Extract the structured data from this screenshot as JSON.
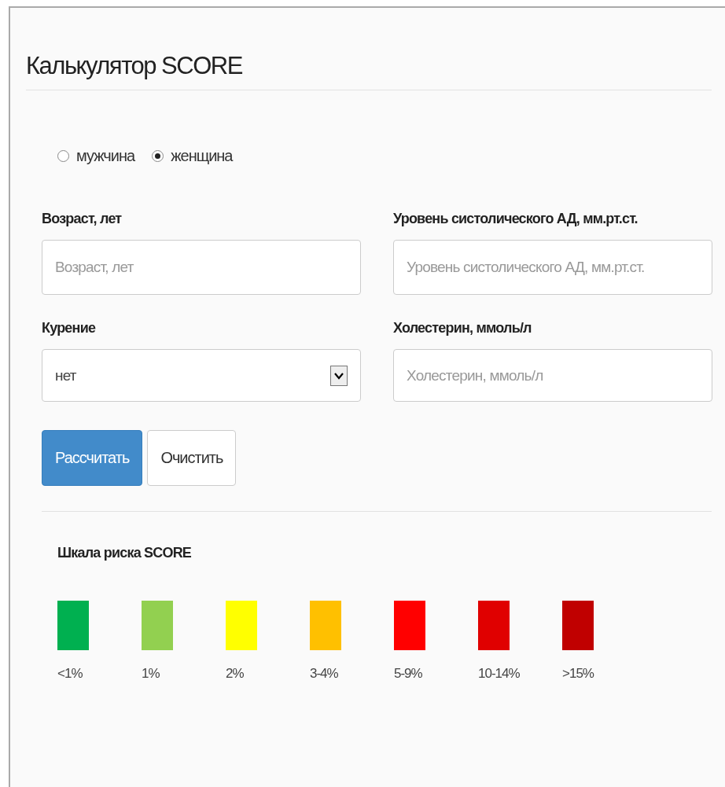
{
  "title": "Калькулятор SCORE",
  "gender": [
    {
      "label": "мужчина",
      "selected": false
    },
    {
      "label": "женщина",
      "selected": true
    }
  ],
  "fields": [
    {
      "kind": "input",
      "label": "Возраст, лет",
      "placeholder": "Возраст, лет"
    },
    {
      "kind": "input",
      "label": "Уровень систолического АД, мм.рт.ст.",
      "placeholder": "Уровень систолического АД, мм.рт.ст."
    },
    {
      "kind": "select",
      "label": "Курение",
      "value": "нет"
    },
    {
      "kind": "input",
      "label": "Холестерин, ммоль/л",
      "placeholder": "Холестерин, ммоль/л"
    }
  ],
  "buttons": [
    {
      "kind": "primary",
      "label": "Рассчитать"
    },
    {
      "kind": "default",
      "label": "Очистить"
    }
  ],
  "scale": {
    "title": "Шкала риска SCORE",
    "items": [
      {
        "label": "<1%",
        "color": "#00b050"
      },
      {
        "label": "1%",
        "color": "#92d050"
      },
      {
        "label": "2%",
        "color": "#ffff00"
      },
      {
        "label": "3-4%",
        "color": "#ffc000"
      },
      {
        "label": "5-9%",
        "color": "#ff0000"
      },
      {
        "label": "10-14%",
        "color": "#e00000"
      },
      {
        "label": ">15%",
        "color": "#c00000"
      }
    ]
  }
}
